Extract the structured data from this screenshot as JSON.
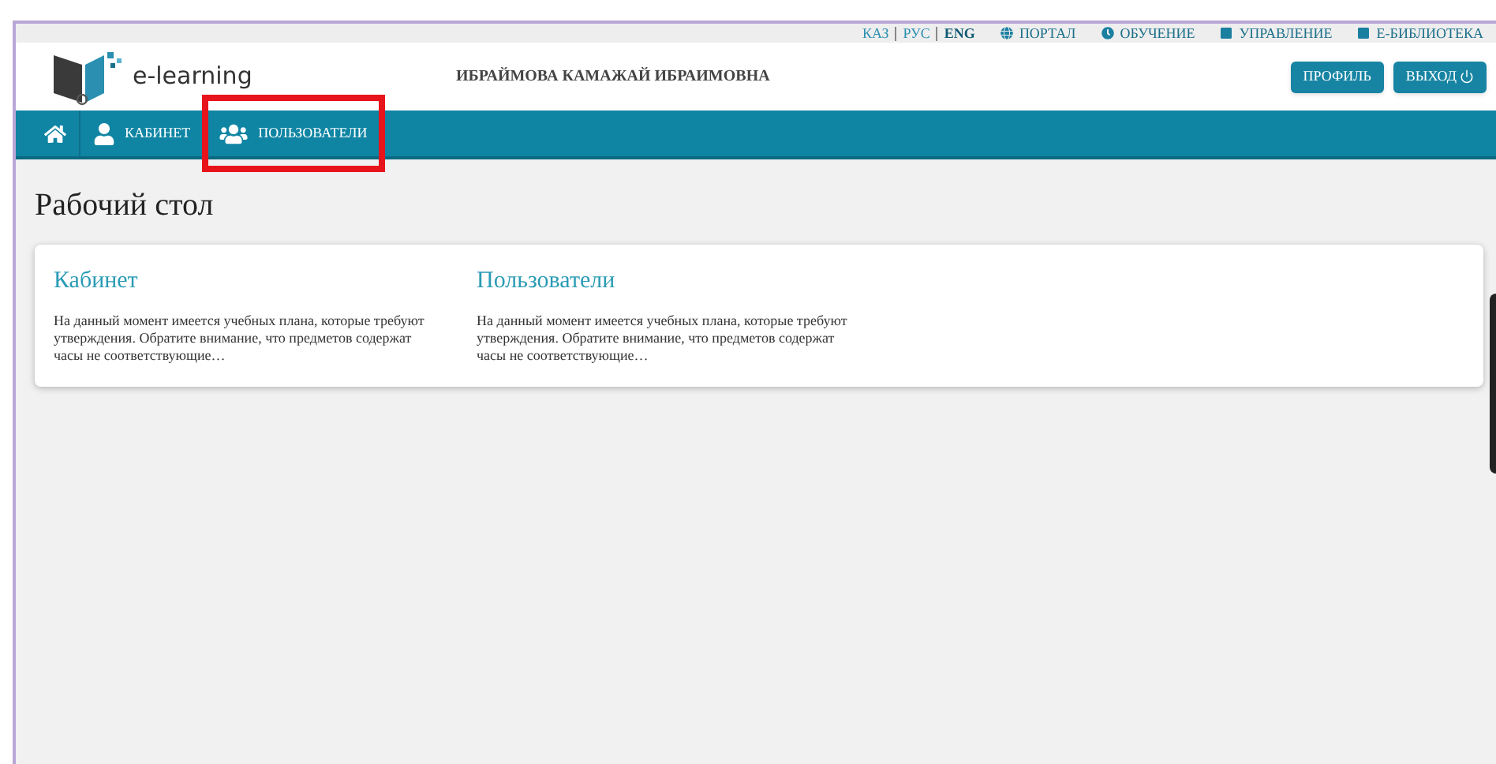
{
  "top_links": {
    "languages": [
      {
        "label": "КАЗ",
        "selected": false
      },
      {
        "label": "РУС",
        "selected": false
      },
      {
        "label": "ENG",
        "selected": true
      }
    ],
    "links": [
      {
        "kind": "globe",
        "label": "ПОРТАЛ"
      },
      {
        "kind": "clock",
        "label": "ОБУЧЕНИЕ"
      },
      {
        "kind": "square",
        "label": "УПРАВЛЕНИЕ"
      },
      {
        "kind": "square",
        "label": "E-БИБЛИОТЕКА"
      }
    ]
  },
  "header": {
    "logo_text": "e-learning",
    "user_name": "ИБРАЙМОВА КАМАЖАЙ ИБРАИМОВНА",
    "buttons": [
      {
        "kind": "plain",
        "label": "ПРОФИЛЬ"
      },
      {
        "kind": "power",
        "label": "ВЫХОД"
      }
    ]
  },
  "nav": [
    {
      "kind": "home",
      "highlighted": false
    },
    {
      "kind": "user",
      "label": "КАБИНЕТ",
      "highlighted": false
    },
    {
      "kind": "users",
      "label": "ПОЛЬЗОВАТЕЛИ",
      "highlighted": true
    }
  ],
  "page_title": "Рабочий стол",
  "cards": [
    {
      "title": "Кабинет",
      "text": "На данный момент имеется учебных плана, которые требуют утверждения. Обратите внимание, что предметов содержат часы не соответствующие…"
    },
    {
      "title": "Пользователи",
      "text": "На данный момент имеется учебных плана, которые требуют утверждения. Обратите внимание, что предметов содержат часы не соответствующие…"
    }
  ]
}
